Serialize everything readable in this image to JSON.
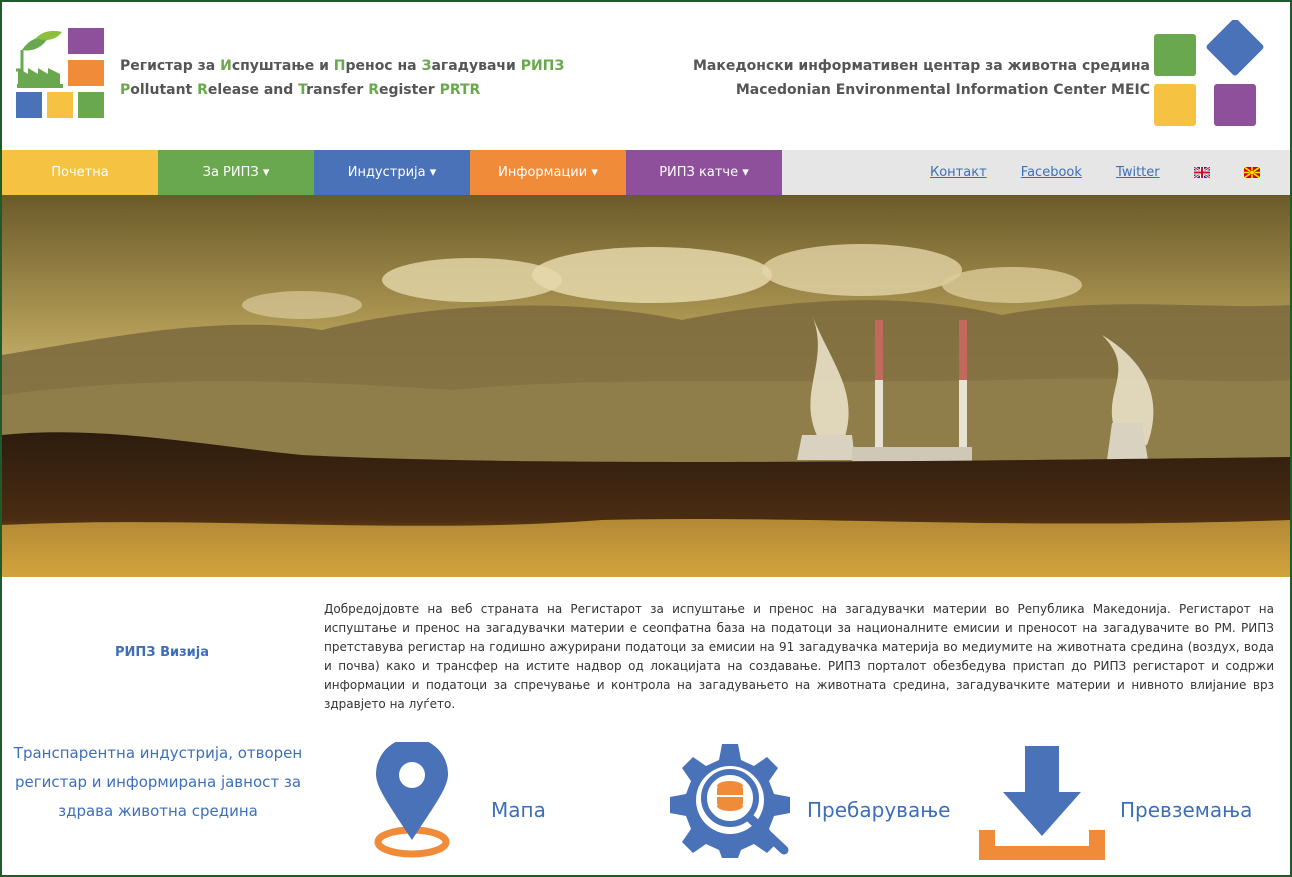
{
  "header": {
    "left_title_line1": [
      {
        "t": "Регистар за ",
        "c": "plain"
      },
      {
        "t": "И",
        "c": "g"
      },
      {
        "t": "спуштање и ",
        "c": "plain"
      },
      {
        "t": "П",
        "c": "g"
      },
      {
        "t": "ренос на ",
        "c": "plain"
      },
      {
        "t": "З",
        "c": "g"
      },
      {
        "t": "агадувачи ",
        "c": "plain"
      },
      {
        "t": "РИПЗ",
        "c": "g"
      }
    ],
    "left_title_line2": [
      {
        "t": "P",
        "c": "g"
      },
      {
        "t": "ollutant ",
        "c": "plain"
      },
      {
        "t": "R",
        "c": "g"
      },
      {
        "t": "elease and ",
        "c": "plain"
      },
      {
        "t": "T",
        "c": "g"
      },
      {
        "t": "ransfer ",
        "c": "plain"
      },
      {
        "t": "R",
        "c": "g"
      },
      {
        "t": "egister ",
        "c": "plain"
      },
      {
        "t": "PRTR",
        "c": "g"
      }
    ],
    "right_title_line1": "Македонски информативен центар за животна средина",
    "right_title_line2": "Macedonian Environmental Information Center MEIC"
  },
  "nav": {
    "items": [
      {
        "label": "Почетна",
        "color": "#f6c242"
      },
      {
        "label": "За РИПЗ ▾",
        "color": "#6aa84f"
      },
      {
        "label": "Индустрија ▾",
        "color": "#4a72b8"
      },
      {
        "label": "Информации ▾",
        "color": "#f08b3a"
      },
      {
        "label": "РИПЗ катче ▾",
        "color": "#8e4f9b"
      }
    ],
    "links": [
      "Контакт",
      "Facebook",
      "Twitter"
    ],
    "flags": [
      "english-flag-icon",
      "macedonian-flag-icon"
    ]
  },
  "content": {
    "vision_title": "РИПЗ Визија",
    "vision_text": "Транспарентна индустрија, отворен регистар и информирана јавност за здрава животна средина",
    "intro": "Добредојдовте на веб страната на Регистарот за испуштање и пренос на загадувачки материи во Република Македонија. Регистарот на испуштање и пренос на загадувачки материи е сеопфатна база на податоци за националните емисии и преносот на загадувачите во РМ. РИПЗ претставува регистар на годишно ажурирани податоци за емисии на 91 загадувачка материја во медиумите на животната средина (воздух, вода и почва) како и трансфер на истите надвор од локацијата на создавање. РИПЗ порталот обезбедува пристап до РИПЗ регистарот и содржи информации и податоци за спречување и контрола на загадувањето на животната средина, загадувачките материи и нивното влијание врз здравјето на луѓето."
  },
  "features": {
    "map": "Мапа",
    "search": "Пребарување",
    "download": "Превземања"
  },
  "colors": {
    "yellow": "#f6c242",
    "green": "#6aa84f",
    "blue": "#4a72b8",
    "orange": "#f08b3a",
    "purple": "#8e4f9b"
  }
}
